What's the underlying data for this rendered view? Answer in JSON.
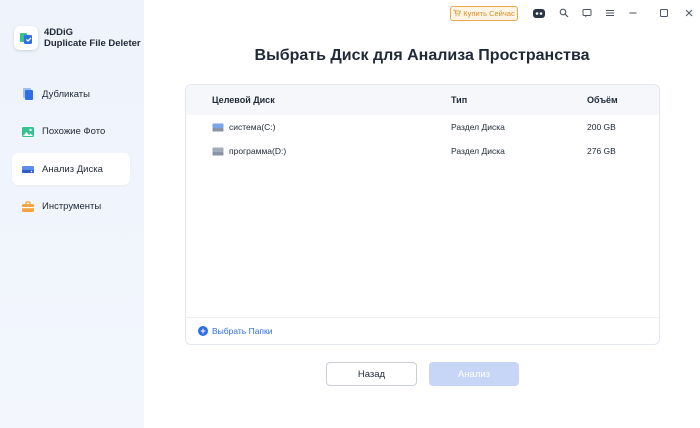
{
  "app": {
    "name_line1": "4DDiG",
    "name_line2": "Duplicate File Deleter"
  },
  "sidebar": {
    "items": [
      {
        "label": "Дубликаты",
        "icon": "duplicate-files-icon",
        "active": false
      },
      {
        "label": "Похожие Фото",
        "icon": "photo-icon",
        "active": false
      },
      {
        "label": "Анализ Диска",
        "icon": "disk-icon",
        "active": true
      },
      {
        "label": "Инструменты",
        "icon": "toolbox-icon",
        "active": false
      }
    ]
  },
  "topbar": {
    "buy_label": "Купить Сейчас",
    "icons": [
      "robot-icon",
      "search-icon",
      "feedback-icon",
      "menu-icon",
      "minimize-icon",
      "maximize-icon",
      "close-icon"
    ]
  },
  "main": {
    "title": "Выбрать Диск для Анализа Пространства",
    "table": {
      "headers": [
        "Целевой Диск",
        "Тип",
        "Объём"
      ],
      "rows": [
        {
          "name": "система(C:)",
          "type": "Раздел Диска",
          "size": "200 GB"
        },
        {
          "name": "программа(D:)",
          "type": "Раздел Диска",
          "size": "276 GB"
        }
      ]
    },
    "select_folders_label": "Выбрать Папки",
    "back_label": "Назад",
    "analyze_label": "Анализ"
  },
  "colors": {
    "accent": "#2f6fe4",
    "buy_orange": "#e08a1e",
    "analyze_disabled": "#c7d6f6"
  }
}
